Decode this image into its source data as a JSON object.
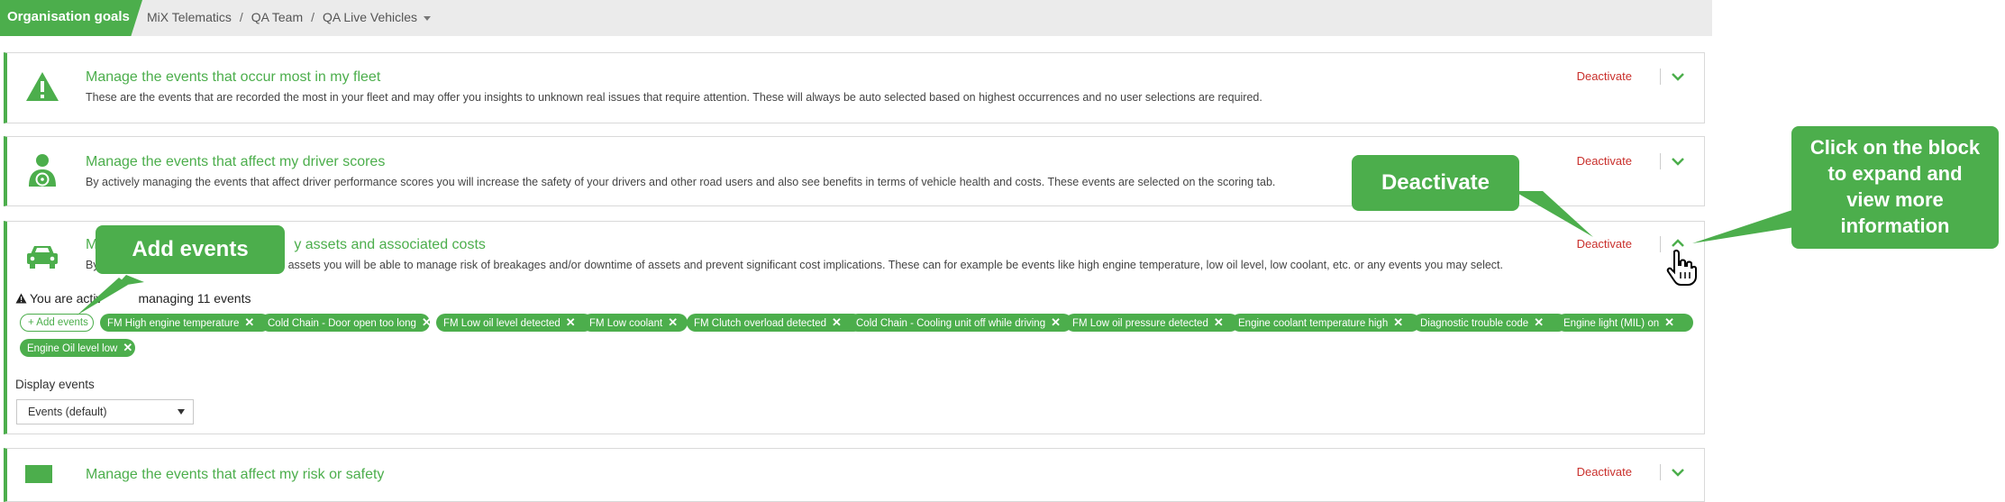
{
  "header": {
    "section_title": "Organisation goals",
    "breadcrumbs": [
      "MiX Telematics",
      "QA Team",
      "QA Live Vehicles"
    ]
  },
  "cards": [
    {
      "title": "Manage the events that occur most in my fleet",
      "description": "These are the events that are recorded the most in your fleet and may offer you insights to unknown real issues that require attention. These will always be auto selected based on highest occurrences and no user selections are required.",
      "action": "Deactivate",
      "icon": "warning-triangle-icon"
    },
    {
      "title": "Manage the events that affect my driver scores",
      "description": "By actively managing the events that affect driver performance scores you will increase the safety of your drivers and other road users and also see benefits in terms of vehicle health and costs. These events are selected on the scoring tab.",
      "action": "Deactivate",
      "icon": "driver-icon"
    },
    {
      "title_start": "M",
      "title_end": "y assets and associated costs",
      "description_start": "By",
      "description_end": "assets you will be able to manage risk of breakages and/or downtime of assets and prevent significant cost implications. These can for example be events like high engine temperature, low oil level, low coolant, etc. or any events you may select.",
      "action": "Deactivate",
      "icon": "car-icon",
      "active_text_start": "You are activ",
      "active_text_end": "managing 11 events",
      "add_label": "+ Add events",
      "tags": [
        "FM High engine temperature",
        "Cold Chain - Door open too long",
        "FM Low oil level detected",
        "FM Low coolant",
        "FM Clutch overload detected",
        "Cold Chain - Cooling unit off while driving",
        "FM Low oil pressure detected",
        "Engine coolant temperature high",
        "Diagnostic trouble code",
        "Engine light (MIL) on",
        "Engine Oil level low"
      ],
      "display_label": "Display events",
      "display_value": "Events (default)"
    },
    {
      "title": "Manage the events that affect my risk or safety",
      "action": "Deactivate"
    }
  ],
  "callouts": {
    "add_events": "Add events",
    "deactivate": "Deactivate",
    "expand_lines": [
      "Click on the block",
      "to expand and",
      "view more",
      "information"
    ]
  },
  "colors": {
    "accent": "#4cae4c",
    "deactivate": "#c9302c"
  }
}
